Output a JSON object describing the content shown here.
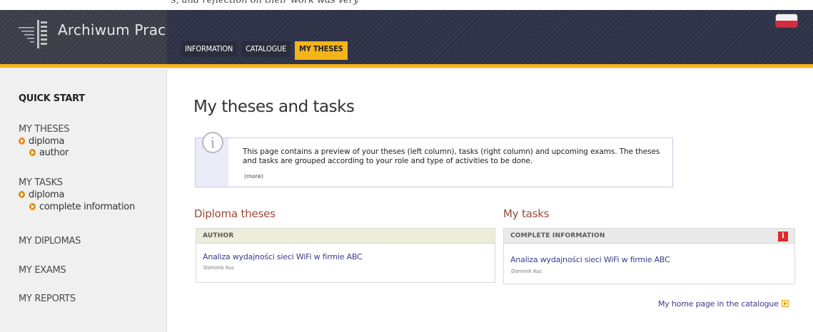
{
  "top_strip_text": "s, and reflection on their work was very",
  "app_title": "Archiwum Prac",
  "nav": {
    "tabs": [
      {
        "label": "INFORMATION",
        "active": false
      },
      {
        "label": "CATALOGUE",
        "active": false
      },
      {
        "label": "MY THESES",
        "active": true
      }
    ]
  },
  "language_flag": "flag-pl-icon",
  "sidebar": {
    "quick_start": "QUICK START",
    "my_theses": "MY THESES",
    "my_theses_diploma": "diploma",
    "my_theses_author": "author",
    "my_tasks": "MY TASKS",
    "my_tasks_diploma": "diploma",
    "my_tasks_complete": "complete information",
    "my_diplomas": "MY DIPLOMAS",
    "my_exams": "MY EXAMS",
    "my_reports": "MY REPORTS"
  },
  "main": {
    "title": "My theses and tasks",
    "info": {
      "text": "This page contains a preview of your theses (left column), tasks (right column) and upcoming exams. The theses and tasks are grouped according to your role and type of activities to be done.",
      "more": "(more)"
    },
    "theses": {
      "title": "Diploma theses",
      "card_header": "AUTHOR",
      "item_title": "Analiza wydajności sieci WiFi w firmie ABC",
      "item_person": "Dominik Kuc"
    },
    "tasks": {
      "title": "My tasks",
      "card_header": "COMPLETE INFORMATION",
      "alert": "i",
      "item_title": "Analiza wydajności sieci WiFi w firmie ABC",
      "item_person": "Dominik Kuc"
    },
    "home_link": "My home page in the catalogue"
  },
  "colors": {
    "accent": "#f4b41a",
    "header_bg": "#2d3145",
    "link": "#3d3a8c",
    "section_title": "#9a4b36",
    "alert": "#d92b2b"
  }
}
